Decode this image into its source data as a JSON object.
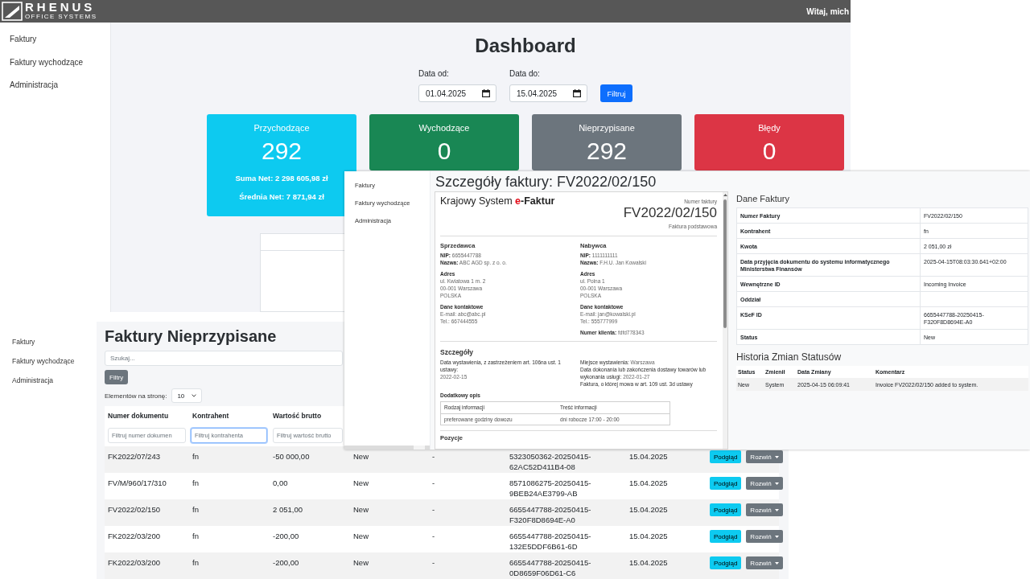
{
  "dashboard_window": {
    "header": {
      "brand": "RHENUS",
      "brand_subtitle": "OFFICE SYSTEMS",
      "greeting": "Witaj, mich"
    },
    "sidebar": {
      "items": [
        {
          "label": "Faktury"
        },
        {
          "label": "Faktury wychodzące"
        },
        {
          "label": "Administracja"
        }
      ]
    },
    "title": "Dashboard",
    "date_filters": [
      {
        "label": "Data od:",
        "value": "01.04.2025"
      },
      {
        "label": "Data do:",
        "value": "15.04.2025"
      }
    ],
    "filter_button": "Filtruj",
    "cards": [
      {
        "title": "Przychodzące",
        "value": "292",
        "color": "#0dcaf0",
        "stats": [
          "Suma Net: 2 298 605,98 zł",
          "Średnia Net: 7 871,94 zł"
        ]
      },
      {
        "title": "Wychodzące",
        "value": "0",
        "color": "#198754"
      },
      {
        "title": "Nieprzypisane",
        "value": "292",
        "color": "#6c757d"
      },
      {
        "title": "Błędy",
        "value": "0",
        "color": "#dc3545"
      }
    ]
  },
  "details_window": {
    "sidebar": {
      "items": [
        {
          "label": "Faktury"
        },
        {
          "label": "Faktury wychodzące"
        },
        {
          "label": "Administracja"
        }
      ]
    },
    "title": "Szczegóły faktury: FV2022/02/150",
    "document": {
      "logo": {
        "prefix": "Krajowy System",
        "accent": "e",
        "suffix": "-Faktur"
      },
      "number_label": "Numer faktury",
      "number": "FV2022/02/150",
      "invoice_type": "Faktura podstawowa",
      "parties": [
        {
          "heading": "Sprzedawca",
          "fields": [
            {
              "label": "NIP:",
              "value": "6655447788"
            },
            {
              "label": "Nazwa:",
              "value": "ABC AGD sp. z o. o."
            }
          ],
          "address_heading": "Adres",
          "address": [
            "ul. Kwiatowa 1 m. 2",
            "00-001 Warszawa",
            "POLSKA"
          ],
          "contact_heading": "Dane kontaktowe",
          "contact": [
            "E-mail: abc@abc.pl",
            "Tel.: 667444555"
          ]
        },
        {
          "heading": "Nabywca",
          "fields": [
            {
              "label": "NIP:",
              "value": "1111111111"
            },
            {
              "label": "Nazwa:",
              "value": "F.H.U. Jan Kowalski"
            }
          ],
          "address_heading": "Adres",
          "address": [
            "ul. Polna 1",
            "00-001 Warszawa",
            "POLSKA"
          ],
          "contact_heading": "Dane kontaktowe",
          "contact": [
            "E-mail: jan@kowalski.pl",
            "Tel.: 555777999"
          ],
          "extra": [
            {
              "label": "Numer klienta:",
              "value": "fdfd778343"
            }
          ]
        }
      ],
      "details": {
        "heading": "Szczegóły",
        "issue_date_label": "Data wystawienia, z zastrzeżeniem art. 106na ust. 1 ustawy:",
        "issue_date": "2022-02-15",
        "fields": [
          {
            "label": "Miejsce wystawienia:",
            "value": "Warszawa"
          },
          {
            "label": "Data dokonania lub zakończenia dostawy towarów lub wykonania usługi:",
            "value": "2022-01-27"
          },
          {
            "label": "Faktura, o której mowa w art. 109 ust. 3d ustawy"
          }
        ]
      },
      "additional": {
        "heading": "Dodatkowy opis",
        "columns": [
          "Rodzaj informacji",
          "Treść informacji"
        ],
        "rows": [
          [
            "preferowane godziny dowozu",
            "dni robocze 17:00 - 20:00"
          ]
        ]
      },
      "next_section": "Pozycje"
    },
    "invoice_data": {
      "heading": "Dane Faktury",
      "rows": [
        {
          "label": "Numer Faktury",
          "value": "FV2022/02/150"
        },
        {
          "label": "Kontrahent",
          "value": "fn"
        },
        {
          "label": "Kwota",
          "value": "2 051,00 zł"
        },
        {
          "label": "Data przyjęcia dokumentu do systemu informatycznego Ministerstwa Finansów",
          "value": "2025-04-15T08:03:30.641+02:00"
        },
        {
          "label": "Wewnętrzne ID",
          "value": "Incoming Invoice"
        },
        {
          "label": "Oddział"
        },
        {
          "label": "KSeF ID",
          "value": "6655447788-20250415-F320F8D8694E-A0"
        },
        {
          "label": "Status",
          "value": "New"
        }
      ]
    },
    "history": {
      "heading": "Historia Zmian Statusów",
      "columns": [
        "Status",
        "Zmienił",
        "Data Zmiany",
        "Komentarz"
      ],
      "rows": [
        [
          "New",
          "System",
          "2025-04-15 06:09:41",
          "Invoice FV2022/02/150 added to system."
        ]
      ]
    }
  },
  "unassigned_window": {
    "sidebar": {
      "items": [
        {
          "label": "Faktury"
        },
        {
          "label": "Faktury wychodzące"
        },
        {
          "label": "Administracja"
        }
      ]
    },
    "title": "Faktury Nieprzypisane",
    "search": {
      "placeholder": "Szukaj..."
    },
    "filters_button": "Filtry",
    "page_size": {
      "label": "Elementów na stronę:",
      "value": "10"
    },
    "table": {
      "columns": [
        "Numer dokumentu",
        "Kontrahent",
        "Wartość brutto"
      ],
      "filters": [
        {
          "placeholder": "Filtruj numer dokumen",
          "focused": false
        },
        {
          "placeholder": "Filtruj kontrahenta",
          "focused": true
        },
        {
          "placeholder": "Filtruj wartość brutto",
          "focused": false
        }
      ],
      "rows": [
        {
          "cells": [
            "FK2022/07/243",
            "fn",
            "-50 000,00",
            "New",
            "-",
            "5323050362-20250415-62AC52D411B4-08",
            "15.04.2025"
          ],
          "actions": [
            {
              "kind": "primary",
              "label": "Podgląd"
            },
            {
              "kind": "dropdown",
              "label": "Rozwiń"
            }
          ]
        },
        {
          "cells": [
            "FV/M/960/17/310",
            "fn",
            "0,00",
            "New",
            "-",
            "8571086275-20250415-9BEB24AE3799-AB",
            "15.04.2025"
          ],
          "actions": [
            {
              "kind": "primary",
              "label": "Podgląd"
            },
            {
              "kind": "dropdown",
              "label": "Rozwiń"
            }
          ]
        },
        {
          "cells": [
            "FV2022/02/150",
            "fn",
            "2 051,00",
            "New",
            "-",
            "6655447788-20250415-F320F8D8694E-A0",
            "15.04.2025"
          ],
          "actions": [
            {
              "kind": "primary",
              "label": "Podgląd"
            },
            {
              "kind": "dropdown",
              "label": "Rozwiń"
            }
          ]
        },
        {
          "cells": [
            "FK2022/03/200",
            "fn",
            "-200,00",
            "New",
            "-",
            "6655447788-20250415-132E5DDF6B61-6D",
            "15.04.2025"
          ],
          "actions": [
            {
              "kind": "primary",
              "label": "Podgląd"
            },
            {
              "kind": "dropdown",
              "label": "Rozwiń"
            }
          ]
        },
        {
          "cells": [
            "FK2022/03/200",
            "fn",
            "-200,00",
            "New",
            "-",
            "6655447788-20250415-0D8659F06D61-C6",
            "15.04.2025"
          ],
          "actions": [
            {
              "kind": "primary",
              "label": "Podgląd"
            },
            {
              "kind": "dropdown",
              "label": "Rozwiń"
            }
          ]
        }
      ]
    }
  }
}
